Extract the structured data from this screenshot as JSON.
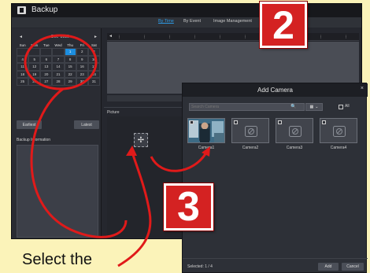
{
  "window": {
    "title": "Backup",
    "tabs": [
      {
        "label": "By Time",
        "active": true
      },
      {
        "label": "By Event",
        "active": false
      },
      {
        "label": "Image Management",
        "active": false
      }
    ]
  },
  "calendar": {
    "month": "Dec",
    "year": "2016",
    "weekdays": [
      "Sun",
      "Mon",
      "Tue",
      "Wed",
      "Thu",
      "Fri",
      "Sat"
    ],
    "weeks": [
      [
        "",
        "",
        "",
        "",
        "1",
        "2",
        "3"
      ],
      [
        "4",
        "5",
        "6",
        "7",
        "8",
        "9",
        "10"
      ],
      [
        "11",
        "12",
        "13",
        "14",
        "15",
        "16",
        "17"
      ],
      [
        "18",
        "19",
        "20",
        "21",
        "22",
        "23",
        "24"
      ],
      [
        "25",
        "26",
        "27",
        "28",
        "29",
        "30",
        "31"
      ]
    ],
    "selected_day": "1",
    "earliest_label": "Earliest",
    "latest_label": "Latest"
  },
  "backup_information_label": "Backup Information",
  "picture_label": "Picture",
  "add_camera_dialog": {
    "title": "Add Camera",
    "search_placeholder": "Search Camera",
    "all_label": "All",
    "cameras": [
      {
        "name": "Camera1",
        "has_image": true
      },
      {
        "name": "Camera2",
        "has_image": false
      },
      {
        "name": "Camera3",
        "has_image": false
      },
      {
        "name": "Camera4",
        "has_image": false
      }
    ],
    "selected_text": "Selected: 1 / 4",
    "add_label": "Add",
    "cancel_label": "Cancel"
  },
  "step_badges": {
    "step2": "2",
    "step3": "3"
  },
  "caption": "Select the",
  "colors": {
    "background": "#fbf3b9",
    "badge_red": "#d42222",
    "annotation_red": "#e01a1a",
    "accent_blue": "#1c8ee0"
  }
}
